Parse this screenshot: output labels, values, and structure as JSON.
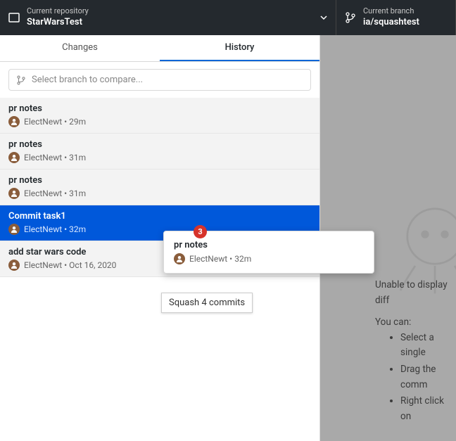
{
  "header": {
    "repo_label": "Current repository",
    "repo_name": "StarWarsTest",
    "branch_label": "Current branch",
    "branch_name": "ia/squashtest"
  },
  "tabs": {
    "changes": "Changes",
    "history": "History"
  },
  "compare": {
    "placeholder": "Select branch to compare..."
  },
  "commits": [
    {
      "title": "pr notes",
      "author": "ElectNewt",
      "time": "29m"
    },
    {
      "title": "pr notes",
      "author": "ElectNewt",
      "time": "31m"
    },
    {
      "title": "pr notes",
      "author": "ElectNewt",
      "time": "31m"
    },
    {
      "title": "Commit task1",
      "author": "ElectNewt",
      "time": "32m",
      "selected": true
    },
    {
      "title": "add star wars code",
      "author": "ElectNewt",
      "time": "Oct 16, 2020"
    }
  ],
  "drag": {
    "count": "3",
    "title": "pr notes",
    "author": "ElectNewt",
    "time": "32m"
  },
  "tooltip": "Squash 4 commits",
  "diff": {
    "heading": "Unable to display diff",
    "youcan": "You can:",
    "options": [
      "Select a single",
      "Drag the comm",
      "Right click on"
    ]
  },
  "sep": " • "
}
